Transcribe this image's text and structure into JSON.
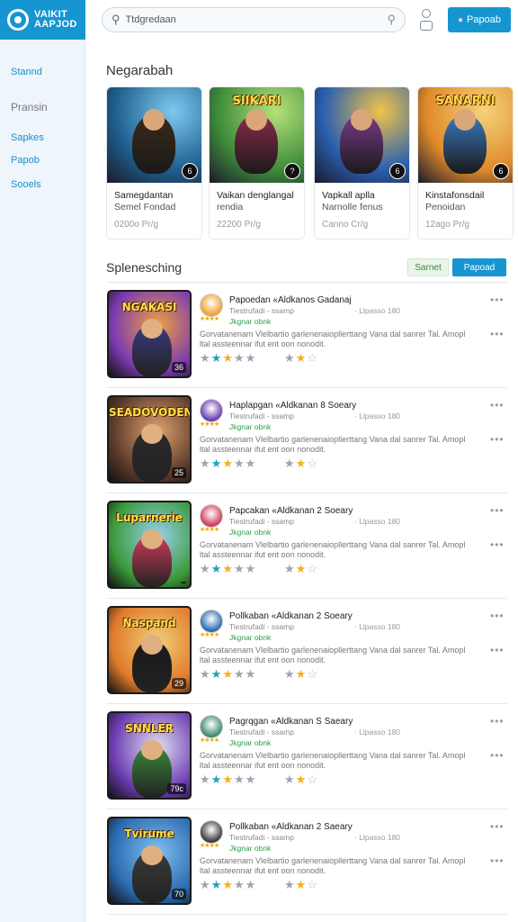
{
  "app": {
    "logo_text_line1": "VAIKIT",
    "logo_text_line2": "AAPJOD"
  },
  "sidebar": {
    "items": [
      {
        "label": "Stannd",
        "style": "blue"
      },
      {
        "label": "Pransin",
        "style": "grey"
      },
      {
        "label": "Sapkes",
        "style": "blue"
      },
      {
        "label": "Papob",
        "style": "blue"
      },
      {
        "label": "Sooels",
        "style": "blue"
      }
    ]
  },
  "header": {
    "search_value": "Ttdgredaan",
    "cta_label": "Papoab"
  },
  "featured": {
    "title": "Negarabah",
    "cards": [
      {
        "art_title": "",
        "badge": "6",
        "title": "Samegdantan",
        "subtitle": "Semel Fondad",
        "price": "0200o Pr/g",
        "palette": [
          "#1e5f8e",
          "#7ec9f0",
          "#3a2a1a"
        ]
      },
      {
        "art_title": "SIIKARI",
        "badge": "?",
        "title": "Vaikan denglangal",
        "subtitle": "rendia",
        "price": "22200 Pr/g",
        "palette": [
          "#3e8b3a",
          "#b5e27a",
          "#8b2a4a"
        ]
      },
      {
        "art_title": "",
        "badge": "6",
        "title": "Vapkall aplla",
        "subtitle": "Narnolle fenus",
        "price": "Canno Cr/g",
        "palette": [
          "#2a5fb0",
          "#f0c34a",
          "#7a3a8a"
        ]
      },
      {
        "art_title": "SANARNI",
        "badge": "6",
        "title": "Kinstafonsdail",
        "subtitle": "Penoidan",
        "price": "12ago Pr/g",
        "palette": [
          "#e08a2a",
          "#f5d27a",
          "#3a7ac0"
        ]
      }
    ]
  },
  "list": {
    "title": "Splenesching",
    "btn_secondary": "Sarnet",
    "btn_primary": "Papoad",
    "rows": [
      {
        "thumb_title": "NGAKASI",
        "thumb_badge": "36",
        "title": "Papoedan «Aldkanos Gadanaj",
        "subtitle": "Tiestrufadi - ssamp",
        "time": "· Llpasso 180",
        "tag": "Jkgnar obnk",
        "desc": "Gorvatanenam Vlelbartio garlenenaiopllerttang Vana dal sanrer Tal. Amopl ltal assteennar ifut ent oon nonodit.",
        "palette": [
          "#7a3ab0",
          "#f0a040",
          "#3a3a80"
        ]
      },
      {
        "thumb_title": "SEADOVODEN",
        "thumb_badge": "25",
        "title": "Haplapgan «Aldkanan 8 Soeary",
        "subtitle": "Tiestrufadi - ssamp",
        "time": "· Llpasso 180",
        "tag": "Jkgnar obnk",
        "desc": "Gorvatanenam Vlelbartio garlenenaiopllerttang Vana dal sanrer Tal. Amopl ltal assteennar ifut ent oon nonodit.",
        "palette": [
          "#5a3a2a",
          "#e0a070",
          "#2a2a2a"
        ]
      },
      {
        "thumb_title": "Luparnerie",
        "thumb_badge": "",
        "title": "Papcakan «Aldkanan 2 Soeary",
        "subtitle": "Tiestrufadi - ssamp",
        "time": "· Llpasso 180",
        "tag": "Jkgnar obnk",
        "desc": "Gorvatanenam Vlelbartio garlenenaiopllerttang Vana dal sanrer Tal. Amopl ltal assteennar ifut ent oon nonodit.",
        "palette": [
          "#3a9a3a",
          "#9ad0f0",
          "#d03a5a"
        ]
      },
      {
        "thumb_title": "Naspand",
        "thumb_badge": "29",
        "title": "Pollkaban «Aldkanan 2 Soeary",
        "subtitle": "Tiestrufadi - ssamp",
        "time": "· Llpasso 180",
        "tag": "Jkgnar obnk",
        "desc": "Gorvatanenam Vlelbartio garlenenaiopllerttang Vana dal sanrer Tal. Amopl ltal assteennar ifut ent oon nonodit.",
        "palette": [
          "#e07a2a",
          "#f0d07a",
          "#1a1a1a"
        ]
      },
      {
        "thumb_title": "SNNLER",
        "thumb_badge": "79c",
        "title": "Pagrqgan «Aldkanan S Saeary",
        "subtitle": "Tiestrufadi - ssamp",
        "time": "· Llpasso 180",
        "tag": "Jkgnar obnk",
        "desc": "Gorvatanenam Vlelbartio garlenenaiopllerttang Vana dal sanrer Tal. Amopl ltal assteennar ifut ent oon nonodit.",
        "palette": [
          "#6a3ab0",
          "#e0e0f0",
          "#3a8a3a"
        ]
      },
      {
        "thumb_title": "Tvirume",
        "thumb_badge": "70",
        "title": "Pollkaban «Aldkanan 2 Saeary",
        "subtitle": "Tiestrufadi - ssamp",
        "time": "· Llpasso 180",
        "tag": "Jkgnar obnk",
        "desc": "Gorvatanenam Vlelbartio garlenenaiopllerttang Vana dal sanrer Tal. Amopl ltal assteennar ifut ent oon nonodit.",
        "palette": [
          "#2a6ab0",
          "#80c0f0",
          "#3a3a3a"
        ]
      }
    ]
  }
}
